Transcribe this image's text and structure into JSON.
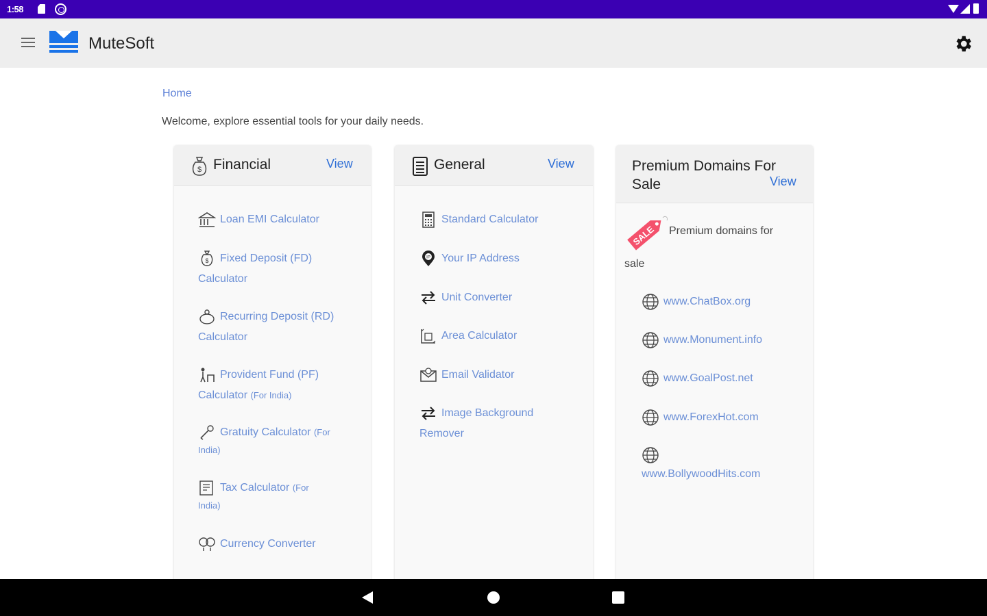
{
  "status_bar": {
    "time": "1:58"
  },
  "app_bar": {
    "title": "MuteSoft"
  },
  "breadcrumb": "Home",
  "welcome": "Welcome, explore essential tools for your daily needs.",
  "financial": {
    "title": "Financial",
    "view": "View",
    "items": [
      {
        "label": "Loan EMI Calculator",
        "icon": "bank-icon"
      },
      {
        "label": "Fixed Deposit (FD)",
        "label2": "Calculator",
        "icon": "money-bag-icon"
      },
      {
        "label": "Recurring Deposit (RD)",
        "label2": "Calculator",
        "icon": "piggy-bank-icon"
      },
      {
        "label": "Provident Fund (PF)",
        "label2": "Calculator",
        "label2_small": "(For India)",
        "icon": "pension-icon"
      },
      {
        "label": "Gratuity Calculator",
        "label_small": "(For",
        "label2_small": "India)",
        "icon": "gratuity-icon"
      },
      {
        "label": "Tax Calculator",
        "label_small": "(For",
        "label2_small": "India)",
        "icon": "tax-icon"
      },
      {
        "label": "Currency Converter",
        "icon": "currency-icon"
      }
    ]
  },
  "general": {
    "title": "General",
    "view": "View",
    "items": [
      {
        "label": "Standard Calculator",
        "icon": "calculator-icon"
      },
      {
        "label": "Your IP Address",
        "icon": "ip-location-icon"
      },
      {
        "label": "Unit Converter",
        "icon": "swap-icon"
      },
      {
        "label": "Area Calculator",
        "icon": "area-icon"
      },
      {
        "label": "Email Validator",
        "icon": "email-icon"
      },
      {
        "label": "Image Background",
        "label2": "Remover",
        "icon": "swap-icon"
      }
    ]
  },
  "domains": {
    "title_line1": "Premium Domains For",
    "title_line2": "Sale",
    "view": "View",
    "intro_line1": "Premium domains for",
    "intro_line2": "sale",
    "sale_tag": "SALE",
    "items": [
      "www.ChatBox.org",
      "www.Monument.info",
      "www.GoalPost.net",
      "www.ForexHot.com",
      "www.BollywoodHits.com"
    ]
  },
  "colors": {
    "status_bar": "#3b00b3",
    "link": "#2f6fd6",
    "link_light": "#6b8fd6",
    "logo_blue": "#1a73e8"
  }
}
